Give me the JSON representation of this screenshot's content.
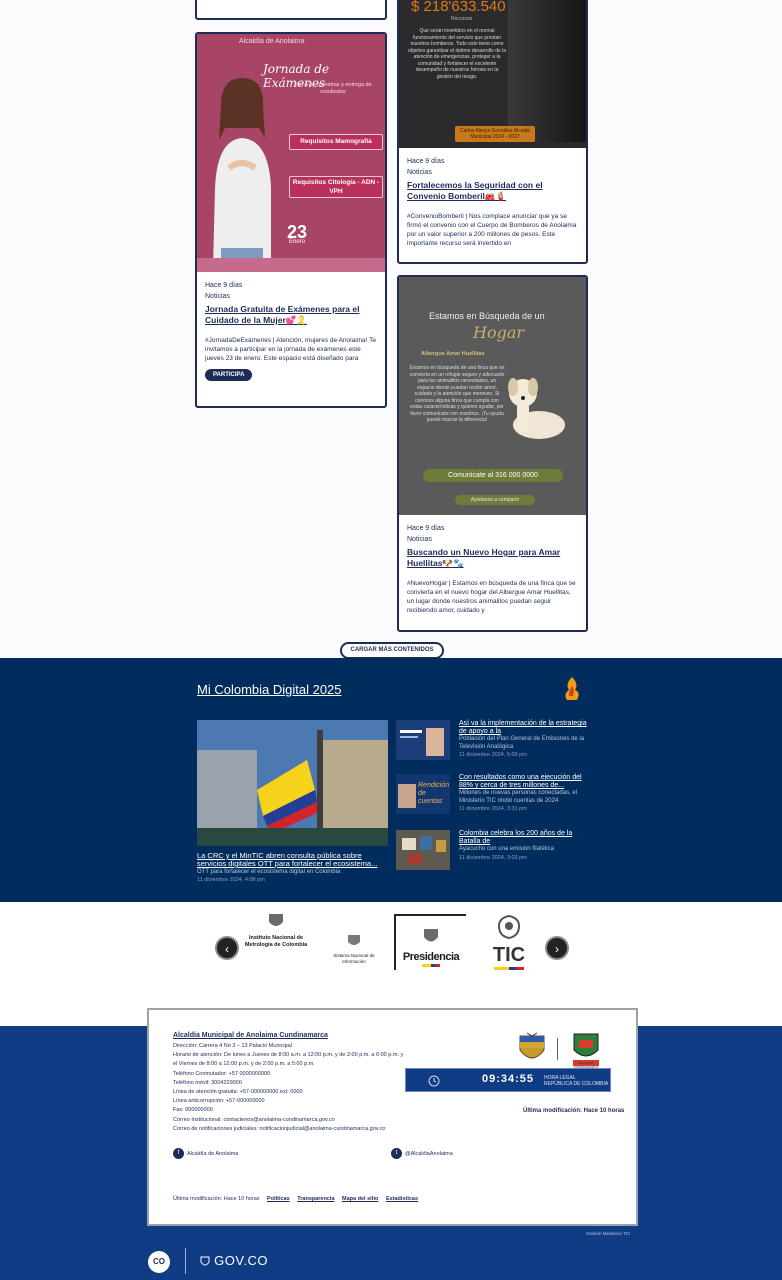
{
  "news": {
    "cards": [
      {
        "meta": "Hace 9 días",
        "category": "Noticias",
        "title": "Jornada Gratuita de Exámenes para el Cuidado de la Mujer💕🎗️",
        "excerpt": "#JornadaDeExámenes | Atención, mujeres de Anolaima! Te invitamos a participar en la jornada de exámenes este jueves 23 de enero. Este espacio está diseñado para promover la salud de la mujer a través de la detección temprana...",
        "button": "PARTICIPA",
        "image": {
          "header": "Alcaldía de Anolaima",
          "script_title": "Jornada de Exámenes",
          "subtitle": "Toma de muestras y entrega de resultados",
          "pill1": "Requisitos Mamografía",
          "pill2": "Requisitos Citología - ADN - VPH",
          "day": "23",
          "month": "Enero"
        }
      },
      {
        "meta": "Hace 9 días",
        "category": "Noticias",
        "title": "Fortalecemos la Seguridad con el Convenio Bomberil🚒🧯",
        "excerpt": "#ConvenioBomberil | Nos complace anunciar que ya se firmó el convenio con el Cuerpo de Bomberos de Anolaima por un valor superior a 200 millones de pesos. Este importante recurso será invertido en",
        "image": {
          "amount": "$ 218'633.540",
          "amount_sub": "Recursos",
          "text": "Que serán invertidos en el normal funcionamiento del servicio que prestan nuestros bomberos. Todo esto tiene como objetivo garantizar el óptimo desarrollo de la atención de emergencias, proteger a la comunidad y fortalecer el excelente desempeño de nuestros héroes en la gestión del riesgo.",
          "badge": "Carlos Alexys González Alcalde Municipal 2024 - 2027"
        }
      },
      {
        "meta": "Hace 9 días",
        "category": "Noticias",
        "title": "Buscando un Nuevo Hogar para Amar Huellitas🐶🐾",
        "excerpt": "#NuevoHogar | Estamos en búsqueda de una finca que se convierta en el nuevo hogar del Albergue Amar Huellitas, un lugar donde nuestros animalitos puedan seguir recibiendo amor, cuidado y",
        "image": {
          "title": "Estamos en Búsqueda de un",
          "hogar": "Hogar",
          "albergue": "Albergue Amar Huellitas",
          "text": "Estamos en búsqueda de una finca que se convierta en un refugio seguro y adecuado para los animalitos necesitados, un espacio donde puedan recibir amor, cuidado y la atención que merecen. Si conoces alguna finca que cumpla con estas características y quieres ayudar, por favor comunícate con nosotros. ¡Tu ayuda puede marcar la diferencia!",
          "contact": "Comunícate al 316 000 0000",
          "contact2": "Ayúdanos a compartir"
        }
      }
    ],
    "load_more": "CARGAR MÁS CONTENIDOS"
  },
  "mi_colombia": {
    "title": "Mi Colombia Digital 2025",
    "main": {
      "title": "La CRC y el MinTIC abren consulta pública sobre servicios digitales OTT para fortalecer el ecosistema...",
      "subtitle": "OTT para fortalecer el ecosistema digital en Colombia",
      "date": "11 diciembre 2024, 4:08 pm"
    },
    "items": [
      {
        "title": "Así va la implementación de la estrategia de apoyo a la",
        "subtitle": "Población del Plan General de Emisiones de la Televisión Analógica",
        "date": "11 diciembre 2024, 5:00 pm"
      },
      {
        "title": "Con resultados como una ejecución del 88% y cerca de tres millones de...",
        "subtitle": "Millones de nuevas personas conectadas, el Ministerio TIC rindió cuentas de 2024",
        "date": "11 diciembre 2024, 3:31 pm"
      },
      {
        "title": "Colombia celebra los 200 años de la Batalla de",
        "subtitle": "Ayacucho con una emisión filatélica",
        "date": "11 diciembre 2024, 3:03 pm"
      }
    ],
    "thumb2_text": "Rendición de cuentas"
  },
  "partners": {
    "logo1": "Instituto Nacional de Metrología de Colombia",
    "logo2": "Sistema Nacional de Información",
    "logo3": "Presidencia",
    "logo4": "TIC",
    "prev": "‹",
    "next": "›"
  },
  "footer": {
    "name": "Alcaldía Municipal de Anolaima Cundinamarca",
    "lines": [
      "Dirección: Carrera 4 No 3 – 13 Palacio Municipal",
      "Horario de atención: De lunes a Jueves de 8:00 a.m. a 12:00 p.m. y de 2:00 p.m. a 6:00 p.m. y",
      "el Viernes de 8:00 a 12:00 p.m. y de 2:00 p.m. a 5:00 p.m.",
      "Teléfono Conmutador: +57 0000000000",
      "Teléfono móvil: 3004229000",
      "Línea de atención gratuita: +57-000000000 ext: 0000",
      "Línea anticorrupción: +57-000000000",
      "Fax: 000000000",
      "Correo Institucional: contactenos@anolaima-cundinamarca.gov.co",
      "Correo de notificaciones judiciales: notificacionjudicial@anolaima-cundinamarca.gov.co"
    ],
    "clock_time": "09:34:55",
    "clock_legal": "HORA LEGAL\nREPÚBLICA DE COLOMBIA",
    "last_mod_right": "Última modificación: Hace 10 horas",
    "social1": "Alcaldía de Anolaima",
    "social2": "@AlcaldiaAnolaima",
    "last_mod_bottom": "Última modificación: Hace 10 horas",
    "links": [
      "Políticas",
      "Transparencia",
      "Mapa del sitio",
      "Estadísticas"
    ],
    "credit": "Gestión Ministerio TIC",
    "coat_label": "ANOLAIMA CUNDINAMARCA"
  },
  "govbar": {
    "badge": "CO",
    "brand": "GOV.CO"
  }
}
